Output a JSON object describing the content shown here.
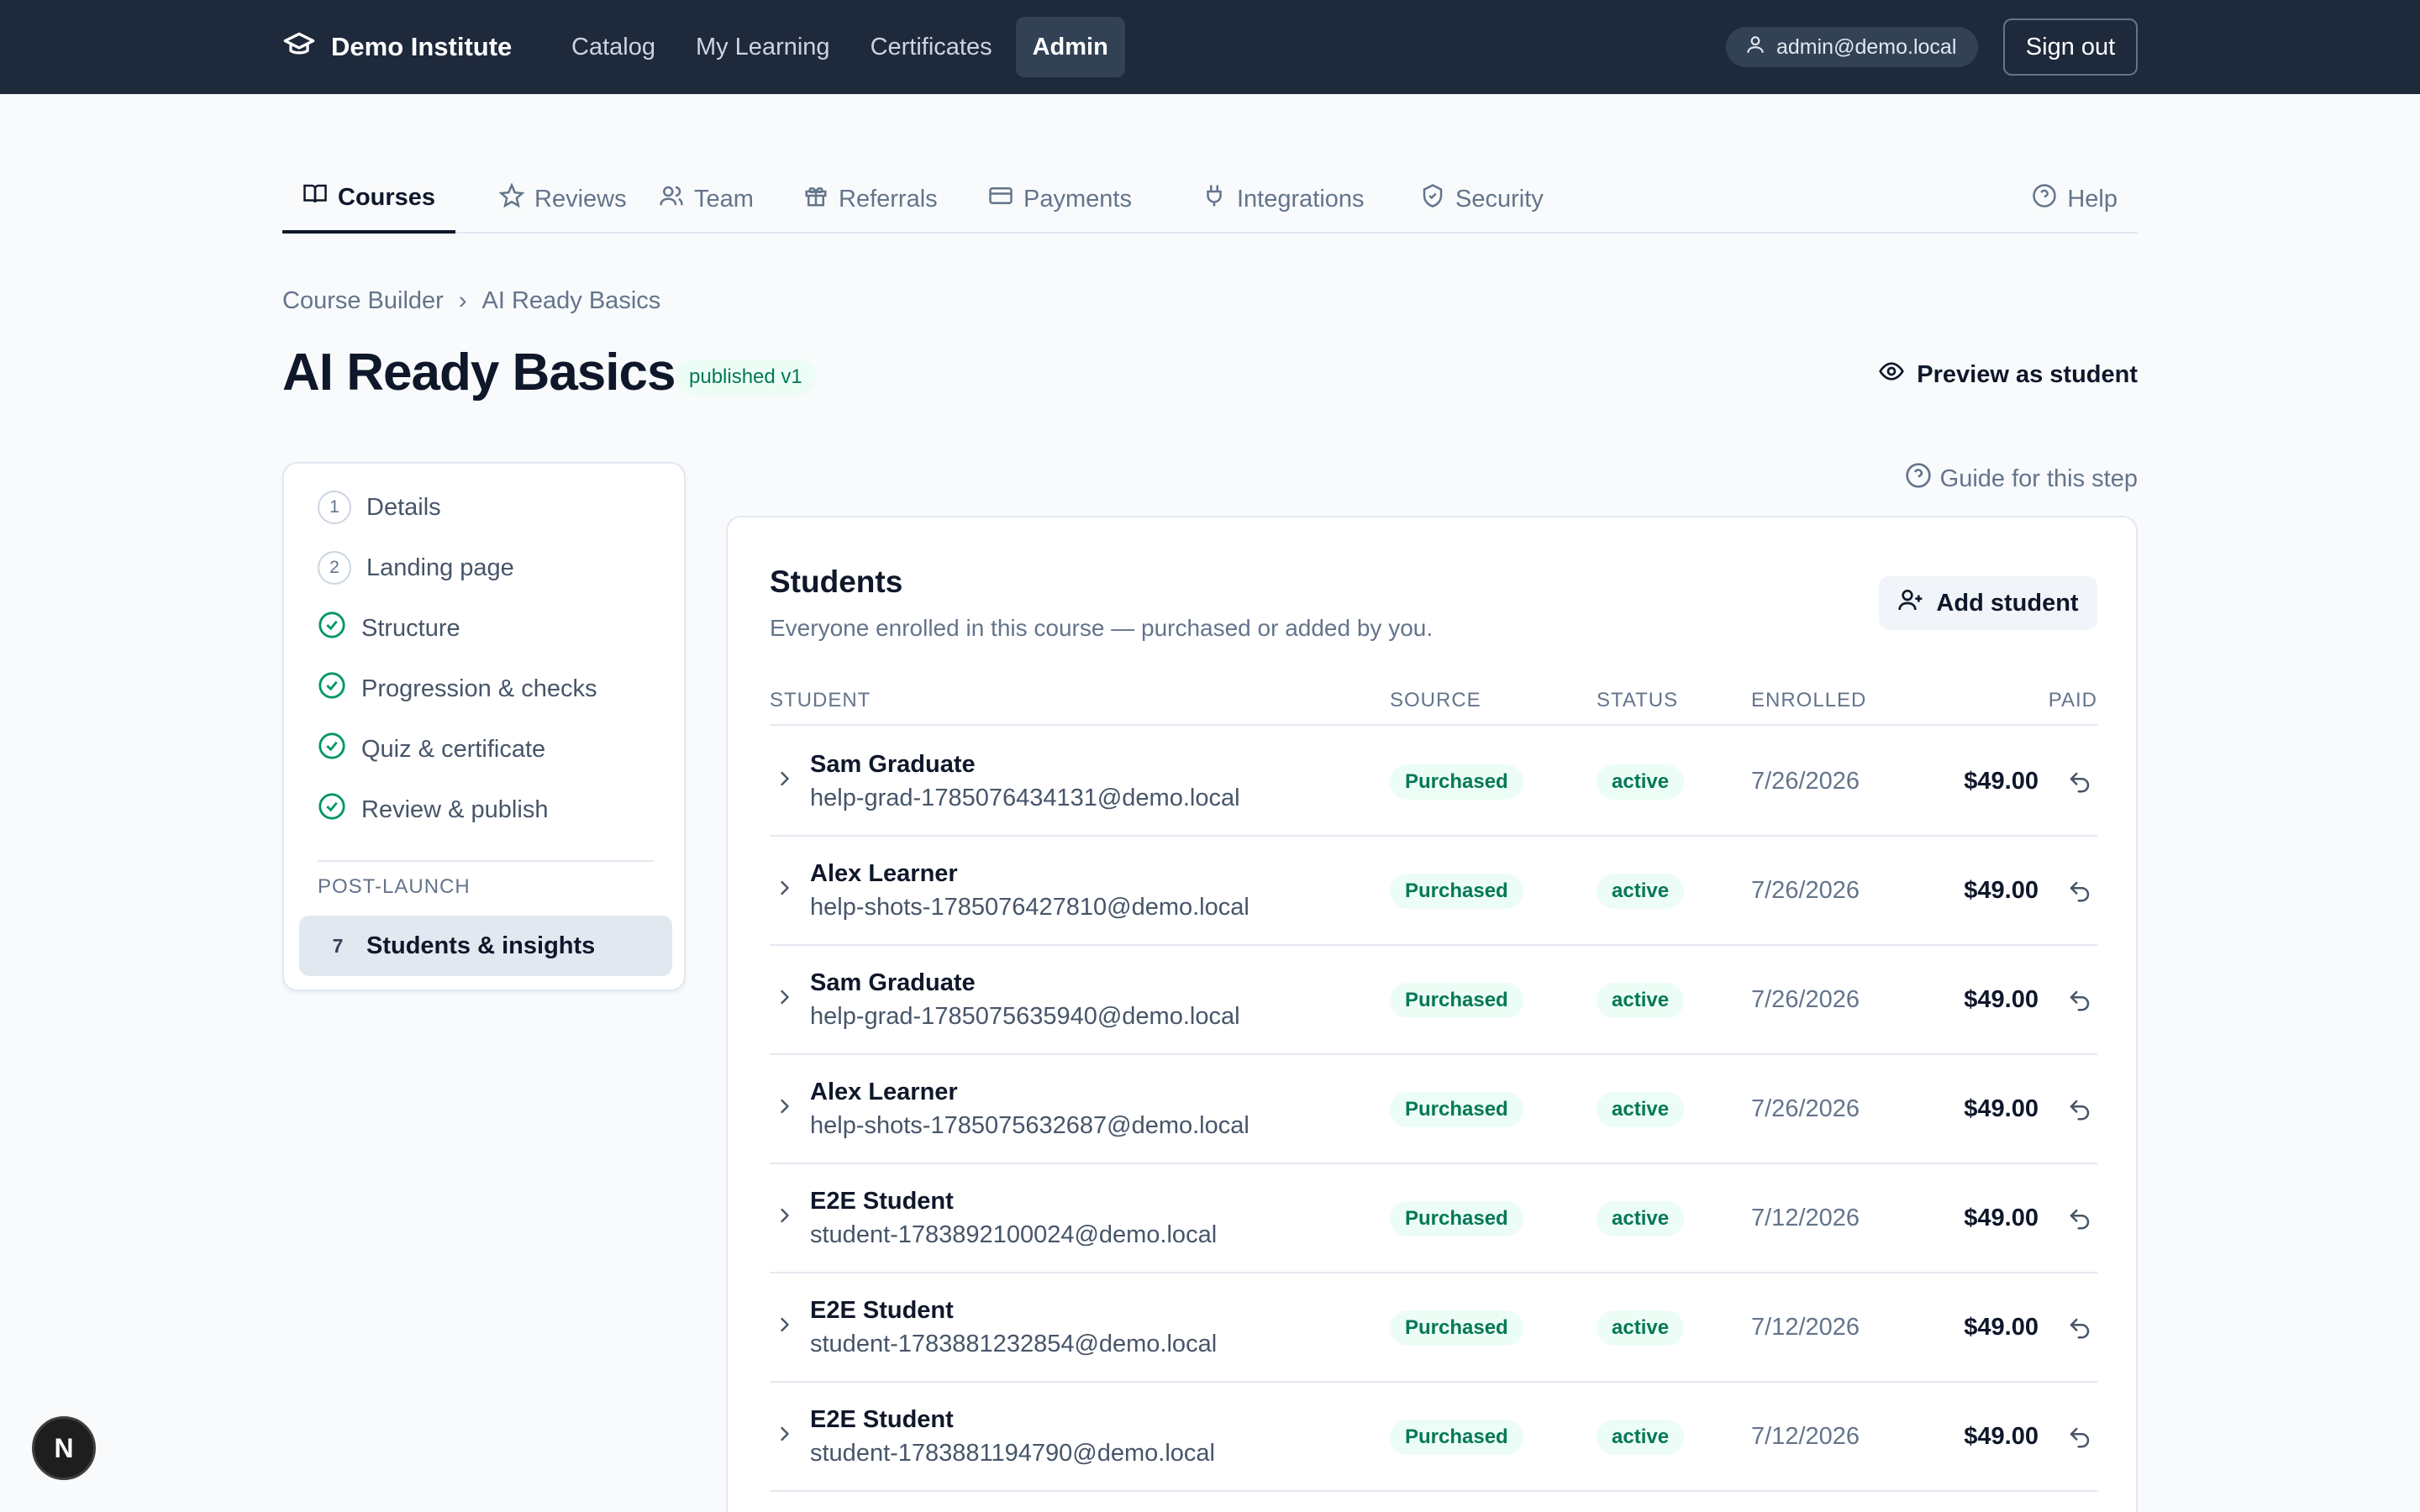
{
  "nav": {
    "brand": "Demo Institute",
    "links": [
      "Catalog",
      "My Learning",
      "Certificates",
      "Admin"
    ],
    "user_email": "admin@demo.local",
    "sign_out": "Sign out"
  },
  "tabs": {
    "items": [
      "Courses",
      "Reviews",
      "Team",
      "Referrals",
      "Payments",
      "Integrations",
      "Security"
    ],
    "help": "Help"
  },
  "breadcrumb": {
    "parent": "Course Builder",
    "separator": "›",
    "current": "AI Ready Basics"
  },
  "page": {
    "title": "AI Ready Basics",
    "badge": "published v1",
    "preview": "Preview as student",
    "guide": "Guide for this step"
  },
  "steps": {
    "items": [
      {
        "marker": "1",
        "label": "Details"
      },
      {
        "marker": "2",
        "label": "Landing page"
      },
      {
        "marker": "check",
        "label": "Structure"
      },
      {
        "marker": "check",
        "label": "Progression & checks"
      },
      {
        "marker": "check",
        "label": "Quiz & certificate"
      },
      {
        "marker": "check",
        "label": "Review & publish"
      }
    ],
    "section_label": "POST-LAUNCH",
    "active": {
      "marker": "7",
      "label": "Students & insights"
    }
  },
  "students": {
    "title": "Students",
    "subtitle": "Everyone enrolled in this course — purchased or added by you.",
    "add_button": "Add student",
    "columns": [
      "STUDENT",
      "SOURCE",
      "STATUS",
      "ENROLLED",
      "PAID"
    ],
    "rows": [
      {
        "name": "Sam Graduate",
        "email": "help-grad-1785076434131@demo.local",
        "source": "Purchased",
        "status": "active",
        "enrolled": "7/26/2026",
        "paid": "$49.00"
      },
      {
        "name": "Alex Learner",
        "email": "help-shots-1785076427810@demo.local",
        "source": "Purchased",
        "status": "active",
        "enrolled": "7/26/2026",
        "paid": "$49.00"
      },
      {
        "name": "Sam Graduate",
        "email": "help-grad-1785075635940@demo.local",
        "source": "Purchased",
        "status": "active",
        "enrolled": "7/26/2026",
        "paid": "$49.00"
      },
      {
        "name": "Alex Learner",
        "email": "help-shots-1785075632687@demo.local",
        "source": "Purchased",
        "status": "active",
        "enrolled": "7/26/2026",
        "paid": "$49.00"
      },
      {
        "name": "E2E Student",
        "email": "student-1783892100024@demo.local",
        "source": "Purchased",
        "status": "active",
        "enrolled": "7/12/2026",
        "paid": "$49.00"
      },
      {
        "name": "E2E Student",
        "email": "student-1783881232854@demo.local",
        "source": "Purchased",
        "status": "active",
        "enrolled": "7/12/2026",
        "paid": "$49.00"
      },
      {
        "name": "E2E Student",
        "email": "student-1783881194790@demo.local",
        "source": "Purchased",
        "status": "active",
        "enrolled": "7/12/2026",
        "paid": "$49.00"
      }
    ]
  },
  "fab": {
    "label": "N"
  },
  "colors": {
    "nav_bg": "#1e293b",
    "accent_green": "#047857",
    "badge_bg": "#ecfdf5"
  }
}
